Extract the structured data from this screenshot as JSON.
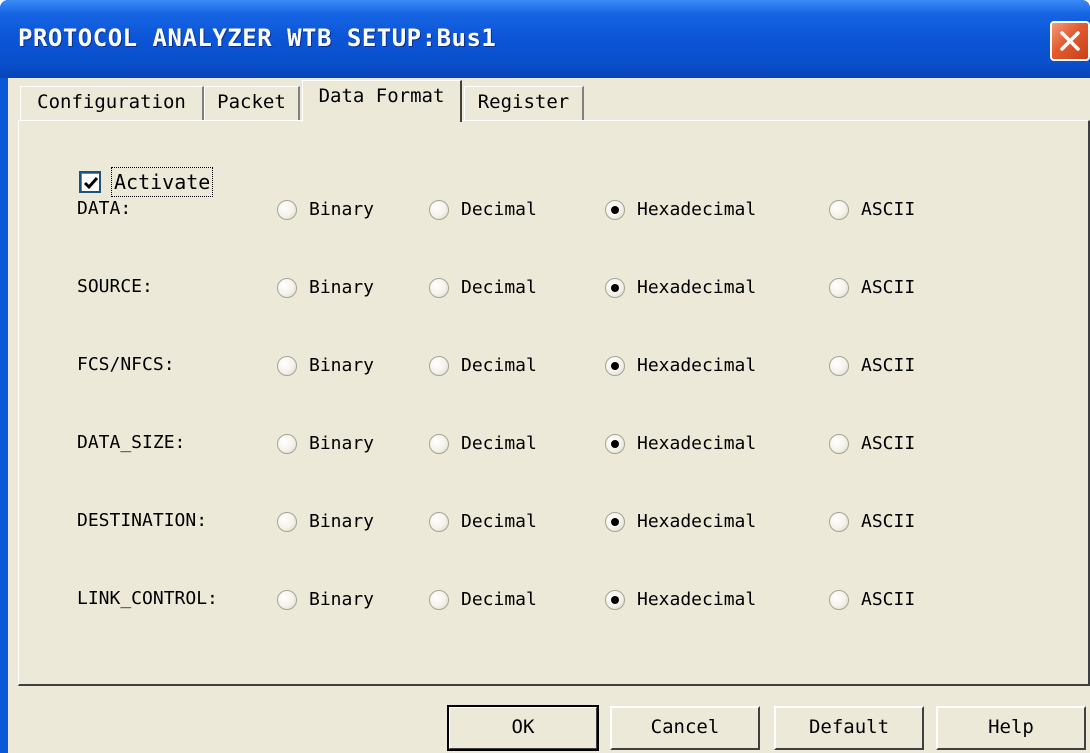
{
  "window": {
    "title": "PROTOCOL ANALYZER WTB SETUP:Bus1"
  },
  "tabs": [
    {
      "label": "Configuration",
      "active": false
    },
    {
      "label": "Packet",
      "active": false
    },
    {
      "label": "Data Format",
      "active": true
    },
    {
      "label": "Register",
      "active": false
    }
  ],
  "activate": {
    "label": "Activate",
    "checked": true
  },
  "format_options": [
    "Binary",
    "Decimal",
    "Hexadecimal",
    "ASCII"
  ],
  "rows": [
    {
      "label": "DATA:",
      "selected": "Hexadecimal"
    },
    {
      "label": "SOURCE:",
      "selected": "Hexadecimal"
    },
    {
      "label": "FCS/NFCS:",
      "selected": "Hexadecimal"
    },
    {
      "label": "DATA_SIZE:",
      "selected": "Hexadecimal"
    },
    {
      "label": "DESTINATION:",
      "selected": "Hexadecimal"
    },
    {
      "label": "LINK_CONTROL:",
      "selected": "Hexadecimal"
    }
  ],
  "buttons": {
    "ok": "OK",
    "cancel": "Cancel",
    "default": "Default",
    "help": "Help"
  },
  "colors": {
    "titlebar": "#0a55d6",
    "dialog_face": "#ece9d8",
    "close_button": "#e25a2e"
  },
  "icons": {
    "close": "close-icon",
    "check": "checkmark-icon"
  }
}
